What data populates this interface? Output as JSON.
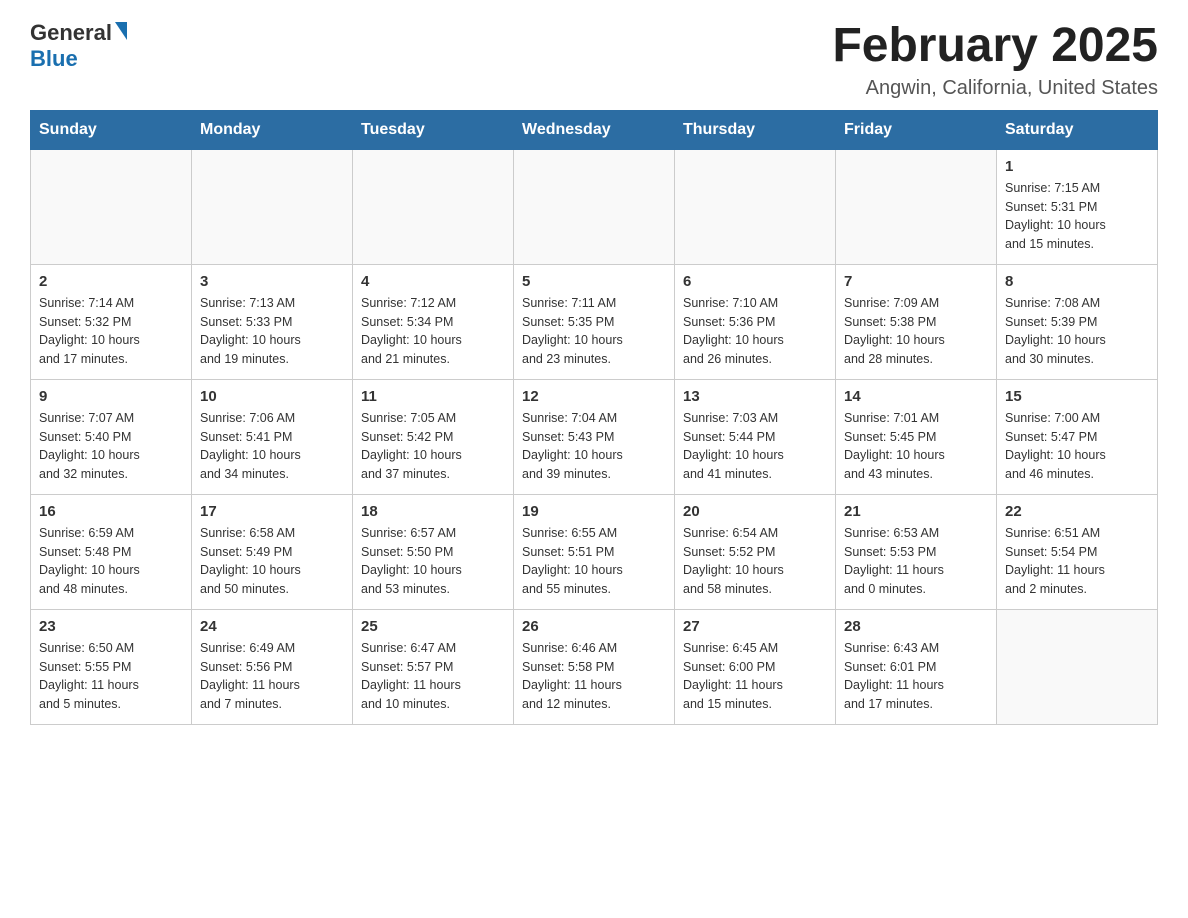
{
  "header": {
    "logo_general": "General",
    "logo_blue": "Blue",
    "title": "February 2025",
    "subtitle": "Angwin, California, United States"
  },
  "days_of_week": [
    "Sunday",
    "Monday",
    "Tuesday",
    "Wednesday",
    "Thursday",
    "Friday",
    "Saturday"
  ],
  "weeks": [
    [
      {
        "day": "",
        "info": ""
      },
      {
        "day": "",
        "info": ""
      },
      {
        "day": "",
        "info": ""
      },
      {
        "day": "",
        "info": ""
      },
      {
        "day": "",
        "info": ""
      },
      {
        "day": "",
        "info": ""
      },
      {
        "day": "1",
        "info": "Sunrise: 7:15 AM\nSunset: 5:31 PM\nDaylight: 10 hours\nand 15 minutes."
      }
    ],
    [
      {
        "day": "2",
        "info": "Sunrise: 7:14 AM\nSunset: 5:32 PM\nDaylight: 10 hours\nand 17 minutes."
      },
      {
        "day": "3",
        "info": "Sunrise: 7:13 AM\nSunset: 5:33 PM\nDaylight: 10 hours\nand 19 minutes."
      },
      {
        "day": "4",
        "info": "Sunrise: 7:12 AM\nSunset: 5:34 PM\nDaylight: 10 hours\nand 21 minutes."
      },
      {
        "day": "5",
        "info": "Sunrise: 7:11 AM\nSunset: 5:35 PM\nDaylight: 10 hours\nand 23 minutes."
      },
      {
        "day": "6",
        "info": "Sunrise: 7:10 AM\nSunset: 5:36 PM\nDaylight: 10 hours\nand 26 minutes."
      },
      {
        "day": "7",
        "info": "Sunrise: 7:09 AM\nSunset: 5:38 PM\nDaylight: 10 hours\nand 28 minutes."
      },
      {
        "day": "8",
        "info": "Sunrise: 7:08 AM\nSunset: 5:39 PM\nDaylight: 10 hours\nand 30 minutes."
      }
    ],
    [
      {
        "day": "9",
        "info": "Sunrise: 7:07 AM\nSunset: 5:40 PM\nDaylight: 10 hours\nand 32 minutes."
      },
      {
        "day": "10",
        "info": "Sunrise: 7:06 AM\nSunset: 5:41 PM\nDaylight: 10 hours\nand 34 minutes."
      },
      {
        "day": "11",
        "info": "Sunrise: 7:05 AM\nSunset: 5:42 PM\nDaylight: 10 hours\nand 37 minutes."
      },
      {
        "day": "12",
        "info": "Sunrise: 7:04 AM\nSunset: 5:43 PM\nDaylight: 10 hours\nand 39 minutes."
      },
      {
        "day": "13",
        "info": "Sunrise: 7:03 AM\nSunset: 5:44 PM\nDaylight: 10 hours\nand 41 minutes."
      },
      {
        "day": "14",
        "info": "Sunrise: 7:01 AM\nSunset: 5:45 PM\nDaylight: 10 hours\nand 43 minutes."
      },
      {
        "day": "15",
        "info": "Sunrise: 7:00 AM\nSunset: 5:47 PM\nDaylight: 10 hours\nand 46 minutes."
      }
    ],
    [
      {
        "day": "16",
        "info": "Sunrise: 6:59 AM\nSunset: 5:48 PM\nDaylight: 10 hours\nand 48 minutes."
      },
      {
        "day": "17",
        "info": "Sunrise: 6:58 AM\nSunset: 5:49 PM\nDaylight: 10 hours\nand 50 minutes."
      },
      {
        "day": "18",
        "info": "Sunrise: 6:57 AM\nSunset: 5:50 PM\nDaylight: 10 hours\nand 53 minutes."
      },
      {
        "day": "19",
        "info": "Sunrise: 6:55 AM\nSunset: 5:51 PM\nDaylight: 10 hours\nand 55 minutes."
      },
      {
        "day": "20",
        "info": "Sunrise: 6:54 AM\nSunset: 5:52 PM\nDaylight: 10 hours\nand 58 minutes."
      },
      {
        "day": "21",
        "info": "Sunrise: 6:53 AM\nSunset: 5:53 PM\nDaylight: 11 hours\nand 0 minutes."
      },
      {
        "day": "22",
        "info": "Sunrise: 6:51 AM\nSunset: 5:54 PM\nDaylight: 11 hours\nand 2 minutes."
      }
    ],
    [
      {
        "day": "23",
        "info": "Sunrise: 6:50 AM\nSunset: 5:55 PM\nDaylight: 11 hours\nand 5 minutes."
      },
      {
        "day": "24",
        "info": "Sunrise: 6:49 AM\nSunset: 5:56 PM\nDaylight: 11 hours\nand 7 minutes."
      },
      {
        "day": "25",
        "info": "Sunrise: 6:47 AM\nSunset: 5:57 PM\nDaylight: 11 hours\nand 10 minutes."
      },
      {
        "day": "26",
        "info": "Sunrise: 6:46 AM\nSunset: 5:58 PM\nDaylight: 11 hours\nand 12 minutes."
      },
      {
        "day": "27",
        "info": "Sunrise: 6:45 AM\nSunset: 6:00 PM\nDaylight: 11 hours\nand 15 minutes."
      },
      {
        "day": "28",
        "info": "Sunrise: 6:43 AM\nSunset: 6:01 PM\nDaylight: 11 hours\nand 17 minutes."
      },
      {
        "day": "",
        "info": ""
      }
    ]
  ]
}
